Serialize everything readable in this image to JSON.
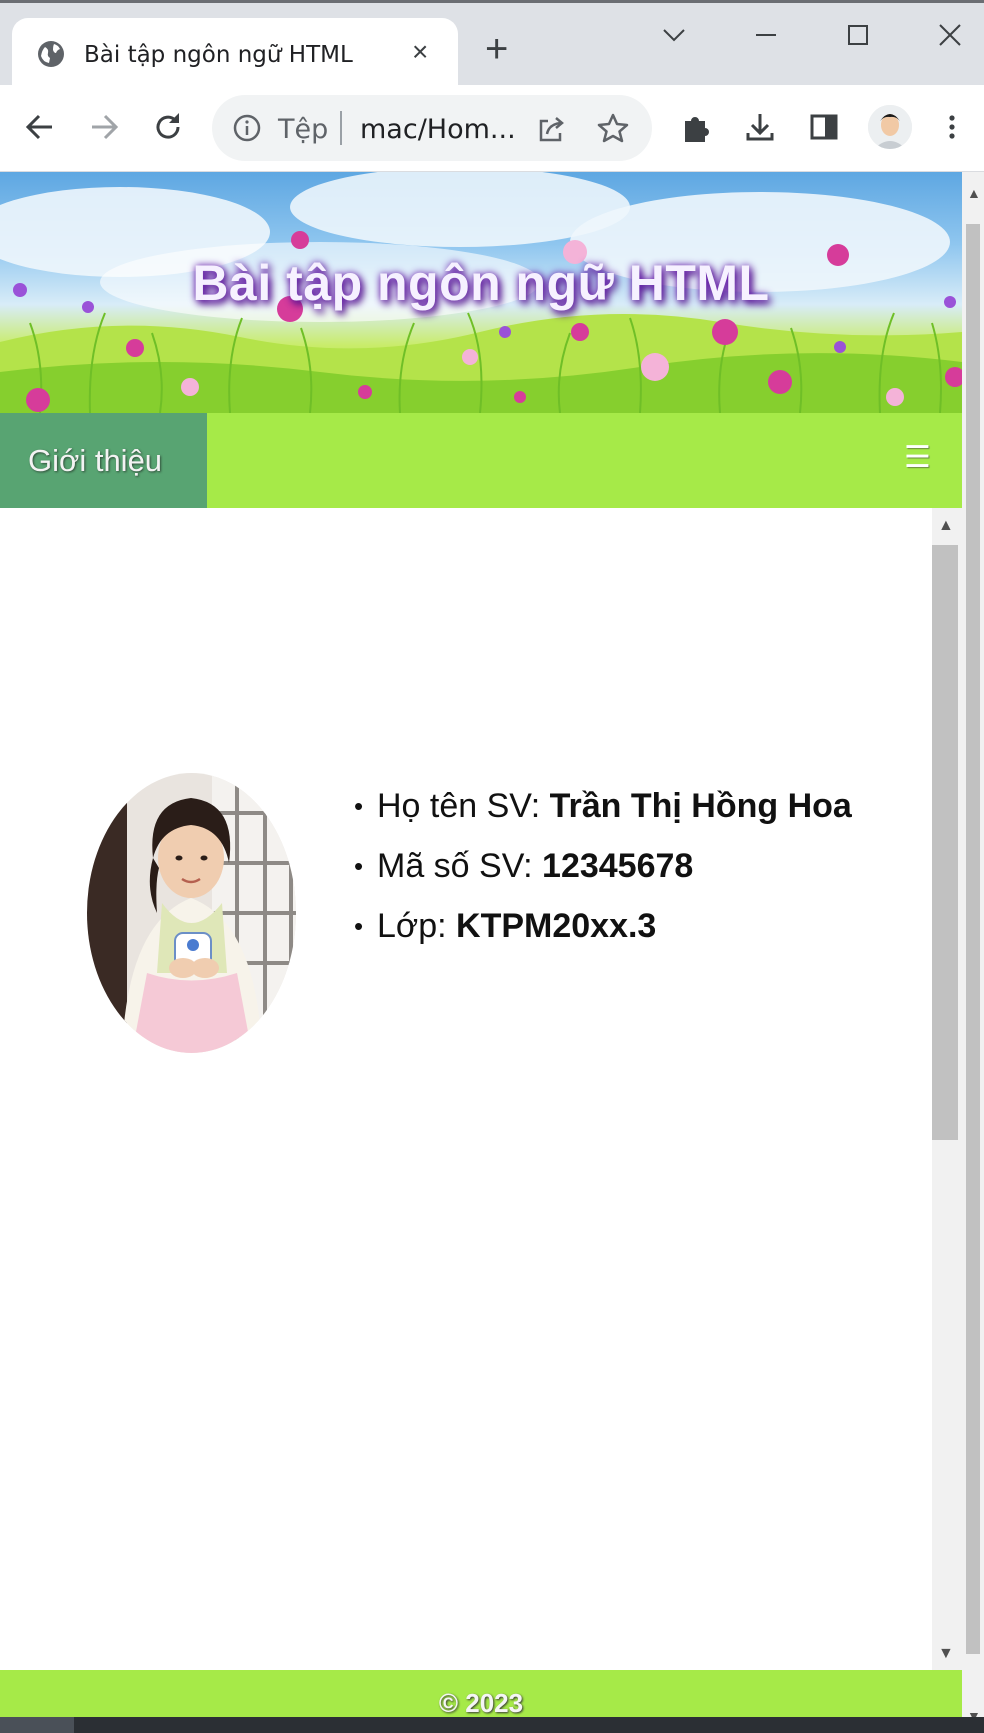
{
  "browser": {
    "tab_title": "Bài tập ngôn ngữ HTML",
    "tab_close": "×",
    "new_tab": "+",
    "omnibox_scheme": "Tệp",
    "omnibox_url": "mac/Hom..."
  },
  "page": {
    "banner_title": "Bài tập ngôn ngữ HTML",
    "nav": {
      "active_item": "Giới thiệu",
      "menu_icon": "☰"
    },
    "student": {
      "items": [
        {
          "label": "Họ tên SV: ",
          "value": "Trần Thị Hồng Hoa"
        },
        {
          "label": "Mã số SV: ",
          "value": "12345678"
        },
        {
          "label": "Lớp: ",
          "value": "KTPM20xx.3"
        }
      ]
    },
    "footer": "© 2023"
  },
  "icons": {
    "tab": "globe-icon",
    "toolbar": [
      "back-arrow-icon",
      "forward-arrow-icon",
      "reload-icon",
      "info-icon",
      "share-icon",
      "star-icon",
      "extensions-icon",
      "download-icon",
      "side-panel-icon",
      "profile-avatar",
      "kebab-menu-icon"
    ],
    "window": [
      "tab-search-chevron-icon",
      "minimize-icon",
      "maximize-icon",
      "close-window-icon"
    ]
  },
  "colors": {
    "navbar": "#a6ea48",
    "nav_active": "#58a472",
    "footer": "#a6ea48",
    "chrome_frame": "#dee1e6"
  }
}
